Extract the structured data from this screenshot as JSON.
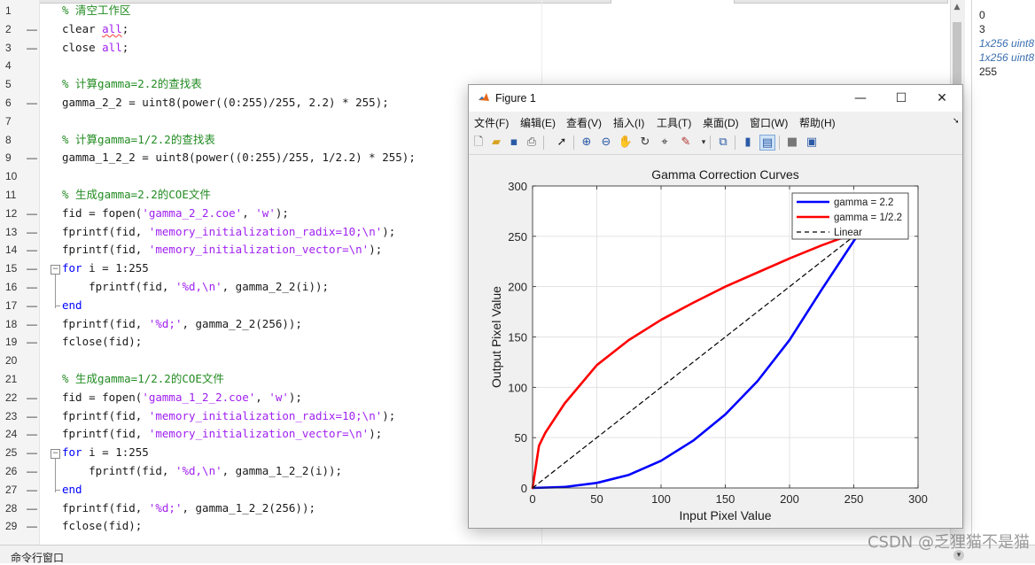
{
  "editor": {
    "lines": [
      {
        "n": "1",
        "dash": "",
        "tokens": [
          {
            "t": "% 清空工作区",
            "c": "c"
          }
        ]
      },
      {
        "n": "2",
        "dash": "—",
        "tokens": [
          {
            "t": "clear ",
            "c": "n"
          },
          {
            "t": "all",
            "c": "u"
          },
          {
            "t": ";",
            "c": "n"
          }
        ]
      },
      {
        "n": "3",
        "dash": "—",
        "tokens": [
          {
            "t": "close ",
            "c": "n"
          },
          {
            "t": "all",
            "c": "s"
          },
          {
            "t": ";",
            "c": "n"
          }
        ]
      },
      {
        "n": "4",
        "dash": "",
        "tokens": []
      },
      {
        "n": "5",
        "dash": "",
        "tokens": [
          {
            "t": "% 计算gamma=2.2的查找表",
            "c": "c"
          }
        ]
      },
      {
        "n": "6",
        "dash": "—",
        "tokens": [
          {
            "t": "gamma_2_2 = uint8(power((0:255)/255, 2.2) * 255);",
            "c": "n"
          }
        ]
      },
      {
        "n": "7",
        "dash": "",
        "tokens": []
      },
      {
        "n": "8",
        "dash": "",
        "tokens": [
          {
            "t": "% 计算gamma=1/2.2的查找表",
            "c": "c"
          }
        ]
      },
      {
        "n": "9",
        "dash": "—",
        "tokens": [
          {
            "t": "gamma_1_2_2 = uint8(power((0:255)/255, 1/2.2) * 255);",
            "c": "n"
          }
        ]
      },
      {
        "n": "10",
        "dash": "",
        "tokens": []
      },
      {
        "n": "11",
        "dash": "",
        "tokens": [
          {
            "t": "% 生成gamma=2.2的COE文件",
            "c": "c"
          }
        ]
      },
      {
        "n": "12",
        "dash": "—",
        "tokens": [
          {
            "t": "fid = fopen(",
            "c": "n"
          },
          {
            "t": "'gamma_2_2.coe'",
            "c": "s"
          },
          {
            "t": ", ",
            "c": "n"
          },
          {
            "t": "'w'",
            "c": "s"
          },
          {
            "t": ");",
            "c": "n"
          }
        ]
      },
      {
        "n": "13",
        "dash": "—",
        "tokens": [
          {
            "t": "fprintf(fid, ",
            "c": "n"
          },
          {
            "t": "'memory_initialization_radix=10;\\n'",
            "c": "s"
          },
          {
            "t": ");",
            "c": "n"
          }
        ]
      },
      {
        "n": "14",
        "dash": "—",
        "tokens": [
          {
            "t": "fprintf(fid, ",
            "c": "n"
          },
          {
            "t": "'memory_initialization_vector=\\n'",
            "c": "s"
          },
          {
            "t": ");",
            "c": "n"
          }
        ]
      },
      {
        "n": "15",
        "dash": "—",
        "fold": "open",
        "tokens": [
          {
            "t": "for",
            "c": "k"
          },
          {
            "t": " i = 1:255",
            "c": "n"
          }
        ]
      },
      {
        "n": "16",
        "dash": "—",
        "tokens": [
          {
            "t": "    fprintf(fid, ",
            "c": "n"
          },
          {
            "t": "'%d,\\n'",
            "c": "s"
          },
          {
            "t": ", gamma_2_2(i));",
            "c": "n"
          }
        ]
      },
      {
        "n": "17",
        "dash": "—",
        "fold": "end",
        "tokens": [
          {
            "t": "end",
            "c": "k"
          }
        ]
      },
      {
        "n": "18",
        "dash": "—",
        "tokens": [
          {
            "t": "fprintf(fid, ",
            "c": "n"
          },
          {
            "t": "'%d;'",
            "c": "s"
          },
          {
            "t": ", gamma_2_2(256));",
            "c": "n"
          }
        ]
      },
      {
        "n": "19",
        "dash": "—",
        "tokens": [
          {
            "t": "fclose(fid);",
            "c": "n"
          }
        ]
      },
      {
        "n": "20",
        "dash": "",
        "tokens": []
      },
      {
        "n": "21",
        "dash": "",
        "tokens": [
          {
            "t": "% 生成gamma=1/2.2的COE文件",
            "c": "c"
          }
        ]
      },
      {
        "n": "22",
        "dash": "—",
        "tokens": [
          {
            "t": "fid = fopen(",
            "c": "n"
          },
          {
            "t": "'gamma_1_2_2.coe'",
            "c": "s"
          },
          {
            "t": ", ",
            "c": "n"
          },
          {
            "t": "'w'",
            "c": "s"
          },
          {
            "t": ");",
            "c": "n"
          }
        ]
      },
      {
        "n": "23",
        "dash": "—",
        "tokens": [
          {
            "t": "fprintf(fid, ",
            "c": "n"
          },
          {
            "t": "'memory_initialization_radix=10;\\n'",
            "c": "s"
          },
          {
            "t": ");",
            "c": "n"
          }
        ]
      },
      {
        "n": "24",
        "dash": "—",
        "tokens": [
          {
            "t": "fprintf(fid, ",
            "c": "n"
          },
          {
            "t": "'memory_initialization_vector=\\n'",
            "c": "s"
          },
          {
            "t": ");",
            "c": "n"
          }
        ]
      },
      {
        "n": "25",
        "dash": "—",
        "fold": "open",
        "tokens": [
          {
            "t": "for",
            "c": "k"
          },
          {
            "t": " i = 1:255",
            "c": "n"
          }
        ]
      },
      {
        "n": "26",
        "dash": "—",
        "tokens": [
          {
            "t": "    fprintf(fid, ",
            "c": "n"
          },
          {
            "t": "'%d,\\n'",
            "c": "s"
          },
          {
            "t": ", gamma_1_2_2(i));",
            "c": "n"
          }
        ]
      },
      {
        "n": "27",
        "dash": "—",
        "fold": "end",
        "tokens": [
          {
            "t": "end",
            "c": "k"
          }
        ]
      },
      {
        "n": "28",
        "dash": "—",
        "tokens": [
          {
            "t": "fprintf(fid, ",
            "c": "n"
          },
          {
            "t": "'%d;'",
            "c": "s"
          },
          {
            "t": ", gamma_1_2_2(256));",
            "c": "n"
          }
        ]
      },
      {
        "n": "29",
        "dash": "—",
        "tokens": [
          {
            "t": "fclose(fid);",
            "c": "n"
          }
        ]
      }
    ]
  },
  "workspace": {
    "values": [
      {
        "text": "0",
        "italic": false
      },
      {
        "text": "3",
        "italic": false
      },
      {
        "text": "1x256 uint8",
        "italic": true
      },
      {
        "text": "1x256 uint8",
        "italic": true
      },
      {
        "text": "255",
        "italic": false
      }
    ]
  },
  "command_window": {
    "label": "命令行窗口"
  },
  "watermark": "CSDN @乏狸猫不是猫",
  "figure": {
    "title": "Figure 1",
    "minimize_glyph": "—",
    "maximize_glyph": "☐",
    "close_glyph": "✕",
    "menus": [
      "文件(F)",
      "编辑(E)",
      "查看(V)",
      "插入(I)",
      "工具(T)",
      "桌面(D)",
      "窗口(W)",
      "帮助(H)"
    ],
    "toolbar_icons": [
      "new-figure-icon",
      "open-file-icon",
      "save-icon",
      "print-icon",
      "pointer-icon",
      "zoom-in-icon",
      "zoom-out-icon",
      "pan-icon",
      "rotate-icon",
      "data-cursor-icon",
      "brush-icon",
      "link-icon",
      "colorbar-icon",
      "legend-icon",
      "hide-plot-tools-icon",
      "show-plot-tools-icon"
    ]
  },
  "chart_data": {
    "type": "line",
    "title": "Gamma Correction Curves",
    "xlabel": "Input Pixel Value",
    "ylabel": "Output Pixel Value",
    "xlim": [
      0,
      300
    ],
    "ylim": [
      0,
      300
    ],
    "xticks": [
      "0",
      "50",
      "100",
      "150",
      "200",
      "250",
      "300"
    ],
    "yticks": [
      "0",
      "50",
      "100",
      "150",
      "200",
      "250",
      "300"
    ],
    "grid": true,
    "legend_position": "top-right",
    "series": [
      {
        "name": "gamma = 2.2",
        "color": "#0000FF",
        "style": "solid",
        "x": [
          0,
          25,
          50,
          75,
          100,
          125,
          150,
          175,
          200,
          225,
          255
        ],
        "y": [
          0,
          1,
          5,
          13,
          27,
          47,
          73,
          106,
          147,
          197,
          255
        ]
      },
      {
        "name": "gamma = 1/2.2",
        "color": "#FF0000",
        "style": "solid",
        "x": [
          0,
          5,
          10,
          25,
          50,
          75,
          100,
          125,
          150,
          175,
          200,
          225,
          255
        ],
        "y": [
          0,
          42,
          55,
          84,
          122,
          147,
          167,
          184,
          200,
          214,
          228,
          241,
          255
        ]
      },
      {
        "name": "Linear",
        "color": "#000000",
        "style": "dashed",
        "x": [
          0,
          255
        ],
        "y": [
          0,
          255
        ]
      }
    ]
  }
}
